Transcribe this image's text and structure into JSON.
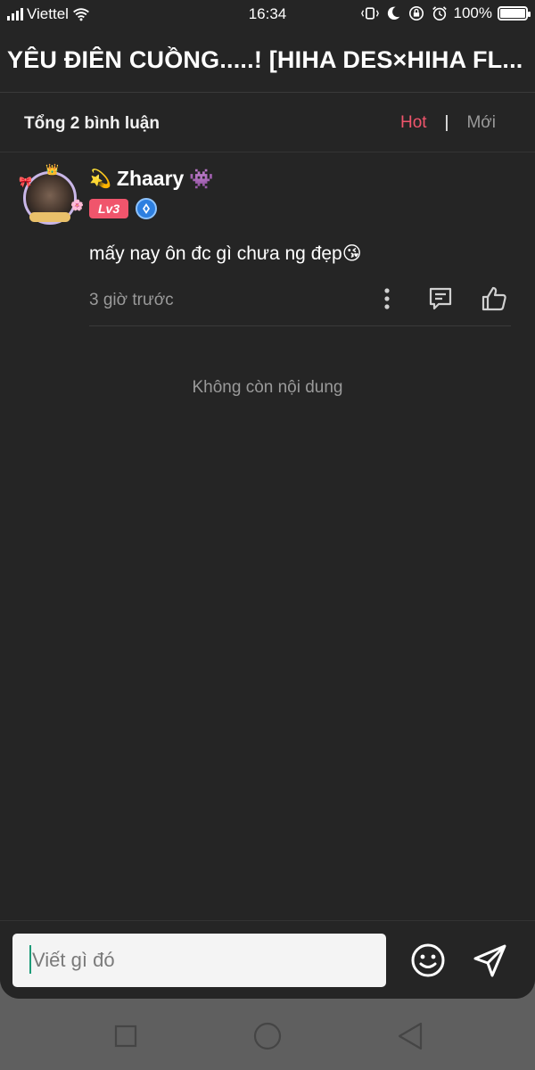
{
  "status_bar": {
    "carrier": "Viettel",
    "time": "16:34",
    "battery": "100%"
  },
  "header": {
    "title": "YÊU ĐIÊN CUỒNG.....! [HIHA DES×HIHA FL..."
  },
  "comments_header": {
    "total": "Tổng 2 bình luận",
    "sort_hot": "Hot",
    "sort_separator": "|",
    "sort_new": "Mới"
  },
  "comments": [
    {
      "username": "Zhaary",
      "prefix_emoji": "💫",
      "suffix_emoji": "👾",
      "level": "Lv3",
      "text": "mấy nay ôn đc gì chưa ng đẹp😘",
      "time": "3 giờ trước"
    }
  ],
  "footer_note": "Không còn nội dung",
  "input": {
    "placeholder": "Viết gì đó"
  },
  "icons": {
    "more": "more-vertical-icon",
    "reply": "comment-icon",
    "like": "thumbs-up-icon",
    "emoji": "smiley-icon",
    "send": "send-icon"
  },
  "colors": {
    "accent": "#f0556c",
    "background": "#252525",
    "muted_text": "#9a9a9a"
  }
}
